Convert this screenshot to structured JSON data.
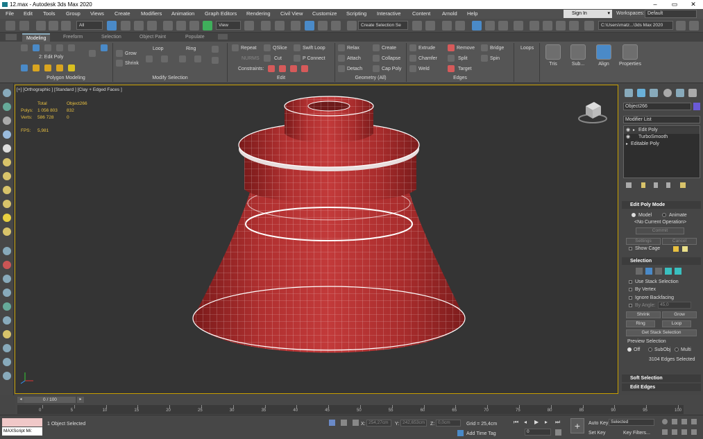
{
  "window": {
    "title": "12.max - Autodesk 3ds Max 2020"
  },
  "menu": [
    "File",
    "Edit",
    "Tools",
    "Group",
    "Views",
    "Create",
    "Modifiers",
    "Animation",
    "Graph Editors",
    "Rendering",
    "Civil View",
    "Customize",
    "Scripting",
    "Interactive",
    "Content",
    "Arnold",
    "Help"
  ],
  "account": {
    "sign_in": "Sign In",
    "workspaces_label": "Workspaces:",
    "workspace": "Default"
  },
  "toolbar": {
    "filter": "All",
    "ref_coord": "View",
    "named_selection": "Create Selection Se",
    "path": "C:\\Users\\matz...\\3ds Max 2020"
  },
  "ribbon_tabs": [
    "Modeling",
    "Freeform",
    "Selection",
    "Object Paint",
    "Populate"
  ],
  "ribbon": {
    "poly_modeling": {
      "current": "2: Edit Poly",
      "title": "Polygon Modeling"
    },
    "modify_selection": {
      "grow": "Grow",
      "shrink": "Shrink",
      "loop": "Loop",
      "ring": "Ring",
      "title": "Modify Selection"
    },
    "edit": {
      "repeat": "Repeat",
      "qslice": "QSlice",
      "swift_loop": "Swift Loop",
      "nurms": "NURMS",
      "cut": "Cut",
      "p_connect": "P Connect",
      "constraints": "Constraints:",
      "title": "Edit"
    },
    "geometry": {
      "relax": "Relax",
      "create": "Create",
      "attach": "Attach",
      "collapse": "Collapse",
      "detach": "Detach",
      "cap_poly": "Cap Poly",
      "title": "Geometry (All)"
    },
    "edges": {
      "extrude": "Extrude",
      "remove": "Remove",
      "bridge": "Bridge",
      "chamfer": "Chamfer",
      "split": "Split",
      "spin": "Spin",
      "weld": "Weld",
      "target": "Target",
      "title": "Edges"
    },
    "loops": "Loops",
    "tris": "Tris",
    "subdivision": "Sub...",
    "align": "Align",
    "properties": "Properties"
  },
  "viewport": {
    "label": "[+] [Orthographic ] [Standard ] [Clay + Edged Faces ]",
    "stats": {
      "total": "Total",
      "object": "Object266",
      "polys_label": "Polys:",
      "polys_total": "1 056 803",
      "polys_obj": "832",
      "verts_label": "Verts:",
      "verts_total": "586 728",
      "verts_obj": "0",
      "fps_label": "FPS:",
      "fps": "5,981"
    }
  },
  "command_panel": {
    "object_name": "Object266",
    "modifier_list": "Modifier List",
    "stack": [
      "Edit Poly",
      "TurboSmooth",
      "Editable Poly"
    ],
    "edit_poly_mode": {
      "title": "Edit Poly Mode",
      "model": "Model",
      "animate": "Animate",
      "current_op": "<No Current Operation>",
      "commit": "Commit",
      "settings": "Settings",
      "cancel": "Cancel",
      "show_cage": "Show Cage"
    },
    "selection": {
      "title": "Selection",
      "use_stack": "Use Stack Selection",
      "by_vertex": "By Vertex",
      "ignore_backfacing": "Ignore Backfacing",
      "by_angle": "By Angle:",
      "angle": "45,0",
      "shrink": "Shrink",
      "grow": "Grow",
      "ring": "Ring",
      "loop": "Loop",
      "get_stack": "Get Stack Selection",
      "preview": "Preview Selection",
      "off": "Off",
      "subobj": "SubObj",
      "multi": "Multi",
      "count": "3104 Edges Selected"
    },
    "soft_selection": "Soft Selection",
    "edit_edges": "Edit Edges"
  },
  "timeline": {
    "frame": "0 / 100",
    "ticks": [
      "0",
      "5",
      "10",
      "15",
      "20",
      "25",
      "30",
      "35",
      "40",
      "45",
      "50",
      "55",
      "60",
      "65",
      "70",
      "75",
      "80",
      "85",
      "90",
      "95",
      "100"
    ]
  },
  "status": {
    "selected": "1 Object Selected",
    "maxscript": "MAXScript Mi:",
    "x_label": "X:",
    "x": "254,27cm",
    "y_label": "Y:",
    "y": "242,653cm",
    "z_label": "Z:",
    "z": "0,0cm",
    "grid": "Grid = 25,4cm",
    "add_time_tag": "Add Time Tag",
    "auto_key": "Auto Key",
    "set_key": "Set Key",
    "selected_drop": "Selected",
    "key_filters": "Key Filters...",
    "frame_field": "0"
  }
}
